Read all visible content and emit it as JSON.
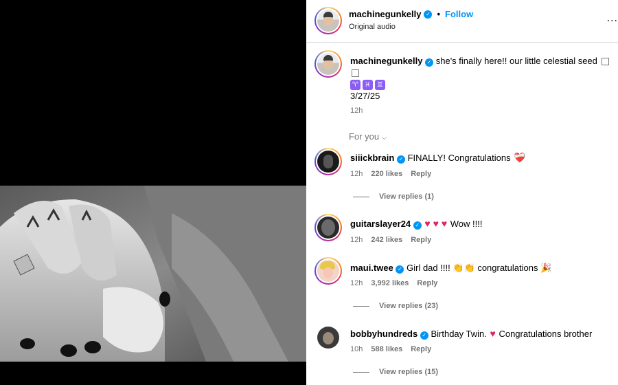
{
  "header": {
    "username": "machinegunkelly",
    "separator": "•",
    "follow_label": "Follow",
    "subtitle": "Original audio",
    "more_label": "..."
  },
  "caption": {
    "username": "machinegunkelly",
    "text": "she's finally here!! our little celestial seed",
    "zodiac": [
      "♈",
      "♓",
      "♊"
    ],
    "date": "3/27/25",
    "time": "12h"
  },
  "filter_label": "For you",
  "comments": [
    {
      "username": "siiickbrain",
      "verified": true,
      "text": "FINALLY! Congratulations",
      "emoji": "❤️‍🩹",
      "time": "12h",
      "likes": "220 likes",
      "reply_label": "Reply",
      "view_replies": "View replies (1)"
    },
    {
      "username": "guitarslayer24",
      "verified": true,
      "hearts": "♥ ♥ ♥",
      "text": "Wow !!!!",
      "time": "12h",
      "likes": "242 likes",
      "reply_label": "Reply"
    },
    {
      "username": "maui.twee",
      "verified": true,
      "text_a": "Girl dad !!!!",
      "claps": "👏👏",
      "text_b": "congratulations",
      "party": "🎉",
      "time": "12h",
      "likes": "3,992 likes",
      "reply_label": "Reply",
      "view_replies": "View replies (23)"
    },
    {
      "username": "bobbyhundreds",
      "verified": true,
      "text_a": "Birthday Twin.",
      "heart": "♥",
      "text_b": "Congratulations brother",
      "time": "10h",
      "likes": "588 likes",
      "reply_label": "Reply",
      "view_replies": "View replies (15)"
    }
  ],
  "colors": {
    "accent": "#0095f6",
    "muted": "#737373",
    "heart": "#e0245e"
  },
  "icons": {
    "verified": "verified-badge-icon",
    "more": "more-options-icon",
    "chevron": "chevron-down-icon"
  }
}
